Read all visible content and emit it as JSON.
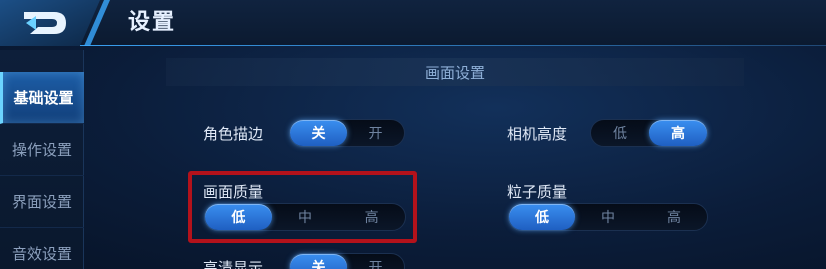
{
  "header": {
    "title": "设置"
  },
  "sidebar": {
    "items": [
      {
        "label": "基础设置",
        "active": true
      },
      {
        "label": "操作设置",
        "active": false
      },
      {
        "label": "界面设置",
        "active": false
      },
      {
        "label": "音效设置",
        "active": false
      }
    ]
  },
  "section": {
    "title": "画面设置"
  },
  "settings": {
    "character_outline": {
      "label": "角色描边",
      "options": [
        "关",
        "开"
      ],
      "selected": "关"
    },
    "camera_height": {
      "label": "相机高度",
      "options": [
        "低",
        "高"
      ],
      "selected": "高"
    },
    "graphics_quality": {
      "label": "画面质量",
      "options": [
        "低",
        "中",
        "高"
      ],
      "selected": "低"
    },
    "particle_quality": {
      "label": "粒子质量",
      "options": [
        "低",
        "中",
        "高"
      ],
      "selected": "低"
    },
    "hd_display": {
      "label": "高清显示",
      "options": [
        "关",
        "开"
      ],
      "selected": "关"
    }
  },
  "colors": {
    "accent": "#2f7fe0",
    "highlight_border": "#b3121b",
    "background": "#0b1d3a"
  }
}
